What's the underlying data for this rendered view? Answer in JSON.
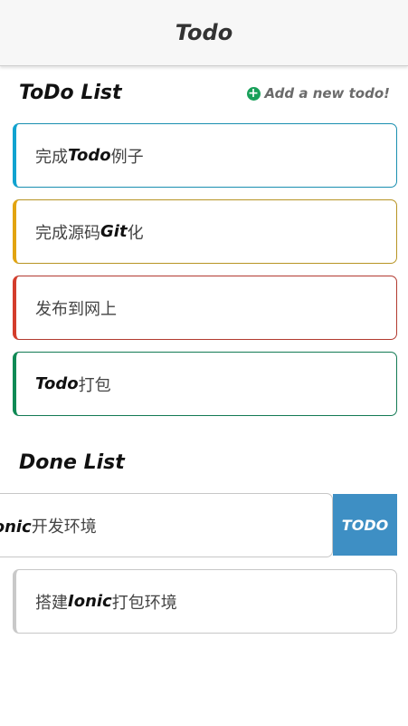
{
  "navbar": {
    "title": "Todo"
  },
  "todo_section": {
    "title": "ToDo List",
    "add_label": "Add a new todo!",
    "add_icon": "plus-circle-icon",
    "items": [
      {
        "pre": "完成",
        "bold": "Todo",
        "post": "例子",
        "color": "#11a3d0"
      },
      {
        "pre": "完成源码",
        "bold": "Git",
        "post": "化",
        "color": "#e2a411"
      },
      {
        "pre": "发布到网上",
        "bold": "",
        "post": "",
        "color": "#d43d2c"
      },
      {
        "pre": "",
        "bold": "Todo",
        "post": "打包",
        "color": "#0f8a55"
      }
    ]
  },
  "done_section": {
    "title": "Done List",
    "items": [
      {
        "pre": "",
        "bold": "Ionic",
        "post": "开发环境",
        "color": "#c9c9c9"
      },
      {
        "pre": "搭建",
        "bold": "Ionic",
        "post": "打包环境",
        "color": "#c9c9c9"
      }
    ],
    "swipe_option_label": "TODO",
    "swipe_option_color": "#3e8fc4"
  }
}
